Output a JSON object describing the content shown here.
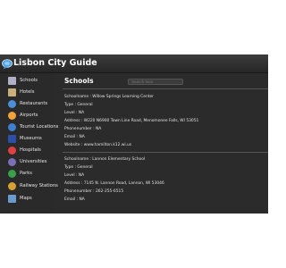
{
  "header": {
    "title": "Lisbon City Guide",
    "logo_icon": "chat-bubble-icon"
  },
  "sidebar": {
    "items": [
      {
        "label": "Schools",
        "icon": "school-bag-icon",
        "color": "#b0b0c8"
      },
      {
        "label": "Hotels",
        "icon": "hotel-icon",
        "color": "#c9b07a"
      },
      {
        "label": "Restaurants",
        "icon": "restaurant-icon",
        "color": "#4a8fd8"
      },
      {
        "label": "Airports",
        "icon": "airport-icon",
        "color": "#f2a33a"
      },
      {
        "label": "Tourist Locations",
        "icon": "tourist-globe-icon",
        "color": "#3d7fd0"
      },
      {
        "label": "Museums",
        "icon": "museum-icon",
        "color": "#2c4fa8"
      },
      {
        "label": "Hospitals",
        "icon": "hospital-cross-icon",
        "color": "#e04040"
      },
      {
        "label": "Universities",
        "icon": "university-icon",
        "color": "#7a6fb8"
      },
      {
        "label": "Parks",
        "icon": "park-icon",
        "color": "#3aa04a"
      },
      {
        "label": "Railway Stations",
        "icon": "train-icon",
        "color": "#d8a030"
      },
      {
        "label": "Maps",
        "icon": "map-icon",
        "color": "#6a9ad0"
      }
    ]
  },
  "main": {
    "section_title": "Schools",
    "search_placeholder": "Search here",
    "records": [
      {
        "school_name": "Schoolname : Willow Springs Learning Center",
        "type": "Type : General",
        "level": "Level : NA",
        "address": "Address : W220 N6900 Town Line Road, Menomonee Falls, WI 53051",
        "phone": "Phonenumber : NA",
        "email": "Email : NA",
        "website": "Website : www.hamilton.k12.wi.us"
      },
      {
        "school_name": "Schoolname : Lannon Elementary School",
        "type": "Type : General",
        "level": "Level : NA",
        "address": "Address : 7145 N. Lannon Road, Lannon, WI 53046",
        "phone": "Phonenumber : 262-255-6515",
        "email": "Email : NA"
      }
    ]
  }
}
